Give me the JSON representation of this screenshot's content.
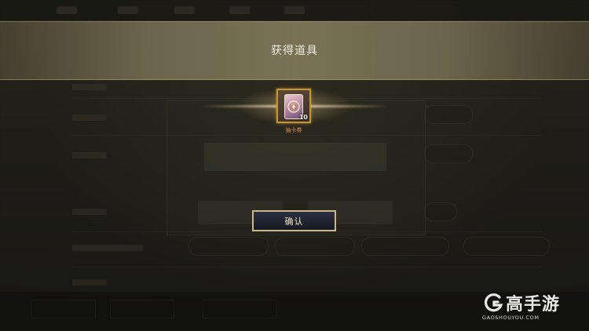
{
  "dialog": {
    "title": "获得道具",
    "confirm_label": "确认"
  },
  "reward": {
    "item_icon": "card-ticket-icon",
    "count": "10",
    "name": "抽卡券"
  },
  "watermark": {
    "logo_icon": "gaoshouyou-logo-icon",
    "brand": "高手游",
    "domain": "GAOSHOUYOU.COM"
  },
  "colors": {
    "item_border": "#c9952e",
    "item_name": "#d88f3c",
    "button_border": "#c8b88a",
    "button_bg": "#151923"
  }
}
